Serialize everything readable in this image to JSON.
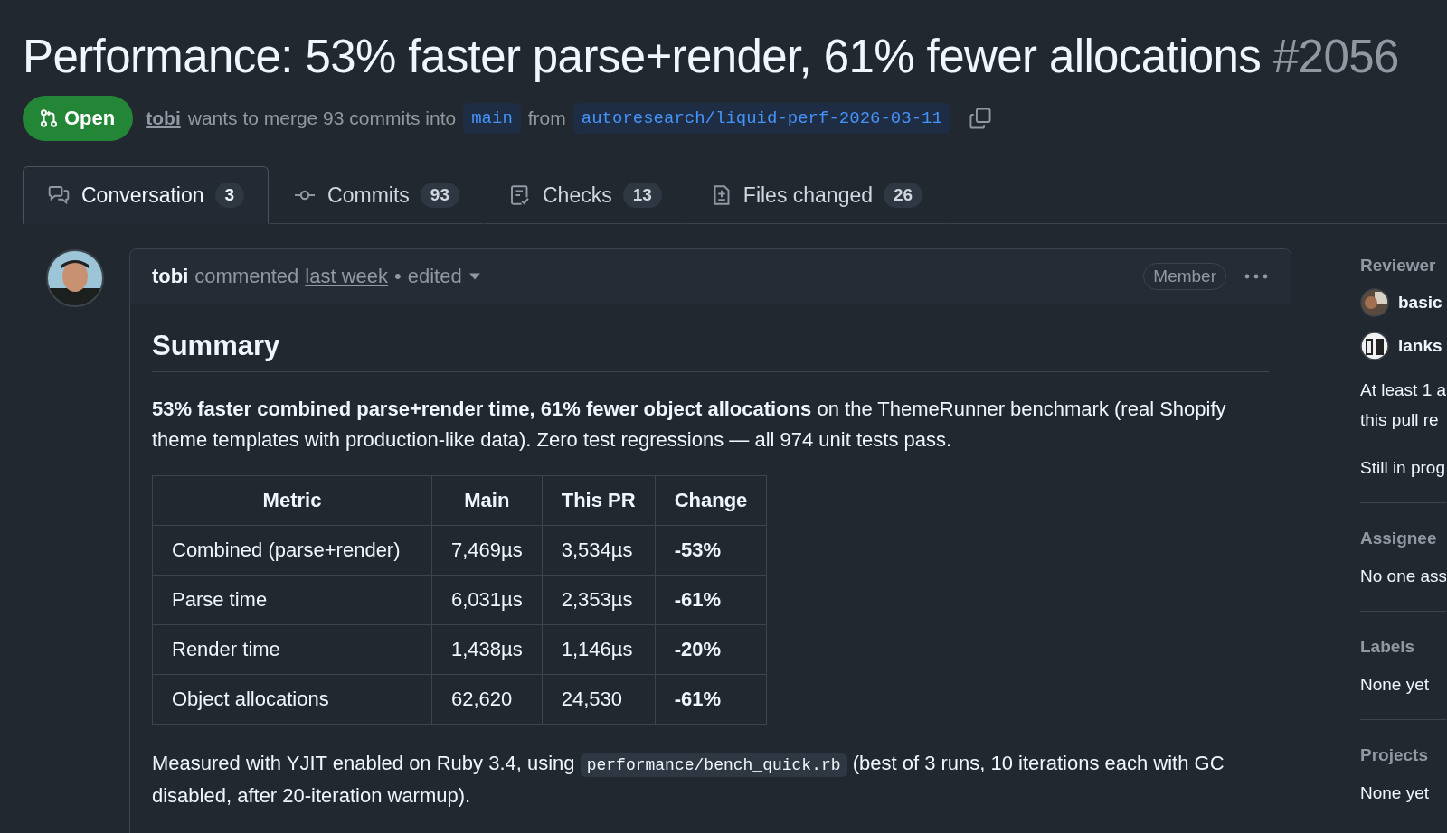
{
  "title": {
    "text": "Performance: 53% faster parse+render, 61% fewer allocations",
    "number": "#2056"
  },
  "state": {
    "kind": "open",
    "label": "Open"
  },
  "merge_info": {
    "author": "tobi",
    "text": "wants to merge 93 commits into",
    "base": "main",
    "joiner": "from",
    "head": "autoresearch/liquid-perf-2026-03-11"
  },
  "tabs": [
    {
      "kind": "conversation",
      "label": "Conversation",
      "count": "3",
      "selected": true
    },
    {
      "kind": "commits",
      "label": "Commits",
      "count": "93",
      "selected": false
    },
    {
      "kind": "checks",
      "label": "Checks",
      "count": "13",
      "selected": false
    },
    {
      "kind": "files",
      "label": "Files changed",
      "count": "26",
      "selected": false
    }
  ],
  "comment": {
    "author": "tobi",
    "action": "commented",
    "time": "last week",
    "separator": "•",
    "edited": "edited",
    "role": "Member",
    "heading": "Summary",
    "intro": "**53% faster combined parse+render time, 61% fewer object allocations** on the ThemeRunner benchmark (real Shopify theme templates with production-like data). Zero test regressions — all 974 unit tests pass.",
    "table": {
      "columns": [
        "Metric",
        "Main",
        "This PR",
        "Change"
      ],
      "rows": [
        [
          "Combined (parse+render)",
          "7,469µs",
          "3,534µs",
          "-53%"
        ],
        [
          "Parse time",
          "6,031µs",
          "2,353µs",
          "-61%"
        ],
        [
          "Render time",
          "1,438µs",
          "1,146µs",
          "-20%"
        ],
        [
          "Object allocations",
          "62,620",
          "24,530",
          "-61%"
        ]
      ]
    },
    "note": {
      "before": "Measured with YJIT enabled on Ruby 3.4, using",
      "code": "performance/bench_quick.rb",
      "after": "(best of 3 runs, 10 iterations each with GC disabled, after 20-iteration warmup)."
    }
  },
  "sidebar": [
    {
      "heading": "Reviewer",
      "reviewers": [
        {
          "name": "basic"
        },
        {
          "name": "ianks"
        }
      ],
      "notes": [
        "At least 1 a",
        "this pull re",
        "Still in prog"
      ]
    },
    {
      "heading": "Assignee",
      "notes": [
        "No one ass"
      ]
    },
    {
      "heading": "Labels",
      "notes": [
        "None yet"
      ]
    },
    {
      "heading": "Projects",
      "notes": [
        "None yet"
      ]
    }
  ]
}
